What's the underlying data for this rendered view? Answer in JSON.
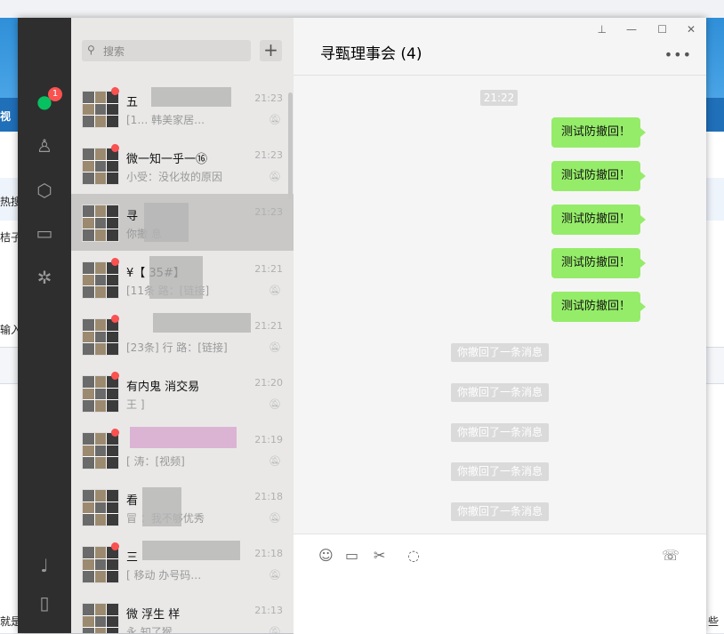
{
  "background": {
    "left_texts": [
      "视",
      "热搜",
      "桔子",
      "输入",
      "就是"
    ],
    "right_text": "些"
  },
  "nav": {
    "unread_badge": "1"
  },
  "search": {
    "placeholder": "搜索"
  },
  "conversations": [
    {
      "name": "五",
      "preview": "[1… 韩美家居…",
      "time": "21:23",
      "unread_dot": true,
      "active": false
    },
    {
      "name": "微一知一乎一⑯",
      "preview": "小受：没化妆的原因",
      "time": "21:23",
      "unread_dot": true,
      "active": false
    },
    {
      "name": "寻",
      "preview": "你撤 息",
      "time": "21:23",
      "unread_dot": false,
      "active": true
    },
    {
      "name": "¥【 35#】",
      "preview": "[11条 路：[链接]",
      "time": "21:21",
      "unread_dot": true,
      "active": false
    },
    {
      "name": "",
      "preview": "[23条] 行 路：[链接]",
      "time": "21:21",
      "unread_dot": true,
      "active": false
    },
    {
      "name": "有内鬼 消交易",
      "preview": "王 ]",
      "time": "21:20",
      "unread_dot": true,
      "active": false
    },
    {
      "name": "",
      "preview": "[ 涛：[视频]",
      "time": "21:19",
      "unread_dot": true,
      "active": false
    },
    {
      "name": "看",
      "preview": "冒 ：我不够优秀",
      "time": "21:18",
      "unread_dot": false,
      "active": false
    },
    {
      "name": "三",
      "preview": "[ 移动 办号码…",
      "time": "21:18",
      "unread_dot": true,
      "active": false
    },
    {
      "name": "微 浮生 样",
      "preview": "永 知了猴 …",
      "time": "21:13",
      "unread_dot": false,
      "active": false
    }
  ],
  "chat": {
    "title": "寻甄理事会 (4)",
    "time_separator": "21:22",
    "sent_messages": [
      "测试防撤回！",
      "测试防撤回！",
      "测试防撤回！",
      "测试防撤回！",
      "测试防撤回！"
    ],
    "recall_notices": [
      "你撤回了一条消息",
      "你撤回了一条消息",
      "你撤回了一条消息",
      "你撤回了一条消息",
      "你撤回了一条消息"
    ]
  },
  "colors": {
    "accent": "#07c160",
    "bubble": "#95ec69",
    "badge": "#fa5151",
    "sidebar": "#2e2e2e"
  },
  "icons": [
    "chat-icon",
    "contacts-icon",
    "favorites-icon",
    "folder-icon",
    "moments-icon",
    "mini-program-icon",
    "phone-icon",
    "emoji-icon",
    "file-icon",
    "scissors-icon",
    "chat-history-icon",
    "video-call-icon",
    "pin-icon",
    "minimize-icon",
    "maximize-icon",
    "close-icon",
    "more-icon",
    "search-icon",
    "add-icon",
    "mute-icon"
  ]
}
